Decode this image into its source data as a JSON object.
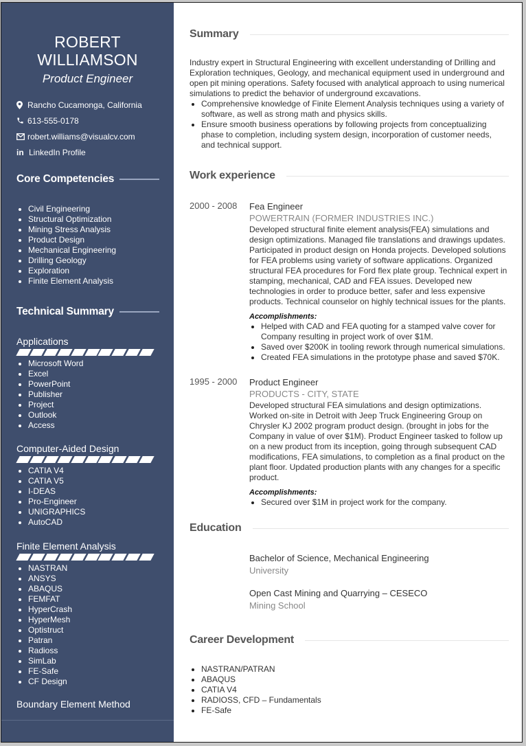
{
  "profile": {
    "first_name": "ROBERT",
    "last_name": "WILLIAMSON",
    "role": "Product Engineer"
  },
  "contact": {
    "location": "Rancho Cucamonga, California",
    "phone": "613-555-0178",
    "email": "robert.williams@visualcv.com",
    "linkedin": "LinkedIn Profile",
    "icons": [
      "map-pin-icon",
      "phone-icon",
      "envelope-icon",
      "linkedin-icon"
    ]
  },
  "sidebar": {
    "core_competencies": {
      "title": "Core Competencies",
      "items": [
        "Civil Engineering",
        "Structural Optimization",
        "Mining Stress Analysis",
        "Product Design",
        "Mechanical Engineering",
        "Drilling Geology",
        "Exploration",
        "Finite Element Analysis"
      ]
    },
    "technical_summary": {
      "title": "Technical Summary",
      "groups": [
        {
          "name": "Applications",
          "level": 10,
          "max": 10,
          "items": [
            "Microsoft Word",
            "Excel",
            "PowerPoint",
            "Publisher",
            "Project",
            "Outlook",
            "Access"
          ]
        },
        {
          "name": "Computer-Aided Design",
          "level": 10,
          "max": 10,
          "items": [
            "CATIA V4",
            "CATIA V5",
            "I-DEAS",
            "Pro-Engineer",
            "UNIGRAPHICS",
            "AutoCAD"
          ]
        },
        {
          "name": "Finite Element Analysis",
          "level": 10,
          "max": 10,
          "items": [
            "NASTRAN",
            "ANSYS",
            "ABAQUS",
            "FEMFAT",
            "HyperCrash",
            "HyperMesh",
            "Optistruct",
            "Patran",
            "Radioss",
            "SimLab",
            "FE-Safe",
            "CF Design"
          ]
        },
        {
          "name": "Boundary Element Method"
        }
      ]
    }
  },
  "summary": {
    "title": "Summary",
    "paragraph": "Industry expert in Structural Engineering with excellent understanding of Drilling and Exploration techniques, Geology, and mechanical equipment used in underground and open pit mining operations. Safety focused with analytical approach to using numerical simulations to predict the behavior of underground excavations.",
    "bullets": [
      "Comprehensive knowledge of Finite Element Analysis techniques using a variety of software, as well as strong math and physics skills.",
      "Ensure smooth business operations by following projects from conceptualizing phase to completion, including system design, incorporation of customer needs, and technical support."
    ]
  },
  "work": {
    "title": "Work experience",
    "jobs": [
      {
        "dates": "2000 - 2008",
        "title": "Fea Engineer",
        "company": "POWERTRAIN (FORMER INDUSTRIES INC.)",
        "description": "Developed structural finite element analysis(FEA) simulations and design optimizations. Managed file translations and drawings updates. Participated in product design on Honda projects. Developed solutions for FEA problems using variety of software applications. Organized structural FEA procedures for Ford flex plate group. Technical expert in stamping, mechanical, CAD and FEA issues. Developed new technologies in order to produce better, safer and less expensive products. Technical counselor on highly technical issues for the plants.",
        "accomplishments_label": "Accomplishments:",
        "accomplishments": [
          "Helped with CAD and FEA quoting for a stamped valve cover for Company resulting in project work of over $1M.",
          "Saved over $200K in tooling rework through numerical simulations.",
          "Created FEA simulations in the prototype phase and saved $70K."
        ]
      },
      {
        "dates": "1995 - 2000",
        "title": "Product Engineer",
        "company": "PRODUCTS - CITY, STATE",
        "description": "Developed structural FEA simulations and design optimizations. Worked on-site in Detroit with Jeep Truck Engineering Group on Chrysler KJ 2002 program product design. (brought in jobs for the Company in value of over $1M). Product Engineer tasked to follow up on a new product from its inception, going through subsequent CAD modifications, FEA simulations, to completion as a final product on the plant floor. Updated production plants with any changes for a specific product.",
        "accomplishments_label": "Accomplishments:",
        "accomplishments": [
          "Secured over $1M in project work for the company."
        ]
      }
    ]
  },
  "education": {
    "title": "Education",
    "entries": [
      {
        "degree": "Bachelor of Science, Mechanical Engineering",
        "school": "University"
      },
      {
        "degree": "Open Cast Mining and Quarrying – CESECO",
        "school": "Mining School"
      }
    ]
  },
  "career": {
    "title": "Career Development",
    "items": [
      "NASTRAN/PATRAN",
      "ABAQUS",
      "CATIA V4",
      "RADIOSS, CFD – Fundamentals",
      "FE-Safe"
    ]
  },
  "colors": {
    "sidebar_bg": "#3f4e6d",
    "heading_gray": "#555555",
    "company_gray": "#888888"
  }
}
